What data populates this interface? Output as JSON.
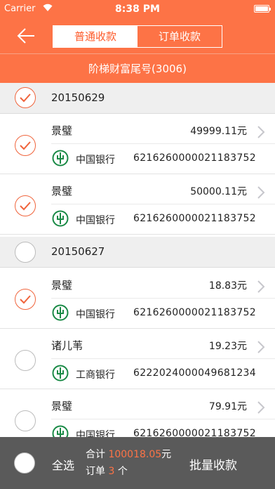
{
  "status_bar": {
    "carrier": "Carrier",
    "time": "8:38 PM"
  },
  "nav": {
    "tabs": [
      {
        "label": "普通收款"
      },
      {
        "label": "订单收款"
      }
    ]
  },
  "subheader": {
    "title": "阶梯财富尾号(3006)"
  },
  "groups": [
    {
      "date": "20150629",
      "items": [
        {
          "name": "景璧",
          "amount": "49999.11元",
          "bank": "中国银行",
          "account": "6216260000021183752"
        },
        {
          "name": "景璧",
          "amount": "50000.11元",
          "bank": "中国银行",
          "account": "6216260000021183752"
        }
      ]
    },
    {
      "date": "20150627",
      "items": [
        {
          "name": "景璧",
          "amount": "18.83元",
          "bank": "中国银行",
          "account": "6216260000021183752"
        },
        {
          "name": "诸儿苇",
          "amount": "19.23元",
          "bank": "工商银行",
          "account": "6222024000049681234"
        },
        {
          "name": "景璧",
          "amount": "79.91元",
          "bank": "中国银行",
          "account": "6216260000021183752"
        }
      ]
    }
  ],
  "footer": {
    "select_all": "全选",
    "total_label": "合计",
    "total_value": "100018.05",
    "total_unit": "元",
    "count_label": "订单",
    "count_value": "3",
    "count_unit": "个",
    "batch_label": "批量收款"
  },
  "colors": {
    "accent": "#fd7346",
    "footer": "#5a5a5a",
    "bank_green": "#1a8a46"
  }
}
